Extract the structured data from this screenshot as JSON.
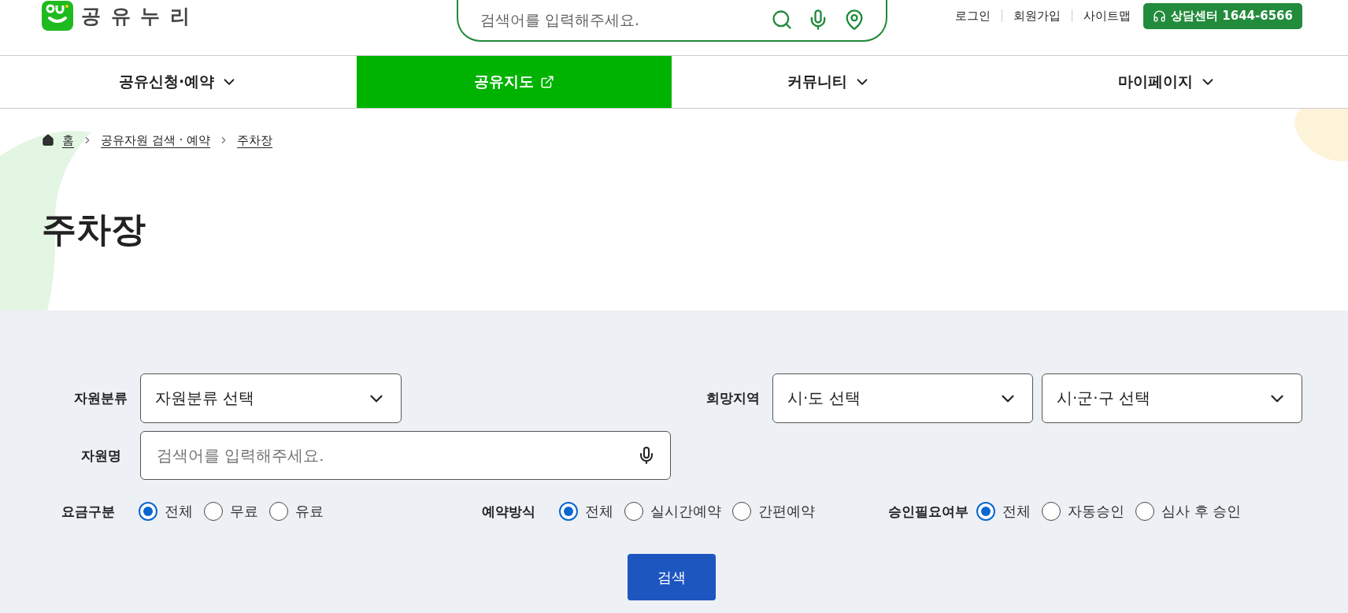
{
  "logo": {
    "text": "공 유 누 리"
  },
  "header_search": {
    "placeholder": "검색어를 입력해주세요."
  },
  "util_links": [
    "로그인",
    "회원가입",
    "사이트맵"
  ],
  "call_center": {
    "label": "상담센터 1644-6566"
  },
  "nav": [
    {
      "label": "공유신청·예약",
      "kind": "dropdown",
      "selected": false
    },
    {
      "label": "공유지도",
      "kind": "external",
      "selected": true
    },
    {
      "label": "커뮤니티",
      "kind": "dropdown",
      "selected": false
    },
    {
      "label": "마이페이지",
      "kind": "dropdown",
      "selected": false
    }
  ],
  "breadcrumb": [
    "홈",
    "공유자원 검색 · 예약",
    "주차장"
  ],
  "page_title": "주차장",
  "filters": {
    "category": {
      "label": "자원분류",
      "value": "자원분류 선택"
    },
    "region": {
      "label": "희망지역",
      "selects": [
        "시·도 선택",
        "시·군·구 선택"
      ]
    },
    "name": {
      "label": "자원명",
      "placeholder": "검색어를 입력해주세요."
    },
    "radio_groups": [
      {
        "label": "요금구분",
        "options": [
          {
            "label": "전체",
            "selected": true
          },
          {
            "label": "무료",
            "selected": false
          },
          {
            "label": "유료",
            "selected": false
          }
        ]
      },
      {
        "label": "예약방식",
        "options": [
          {
            "label": "전체",
            "selected": true
          },
          {
            "label": "실시간예약",
            "selected": false
          },
          {
            "label": "간편예약",
            "selected": false
          }
        ]
      },
      {
        "label": "승인필요여부",
        "options": [
          {
            "label": "전체",
            "selected": true
          },
          {
            "label": "자동승인",
            "selected": false
          },
          {
            "label": "심사 후 승인",
            "selected": false
          }
        ]
      }
    ],
    "search_button": "검색"
  }
}
